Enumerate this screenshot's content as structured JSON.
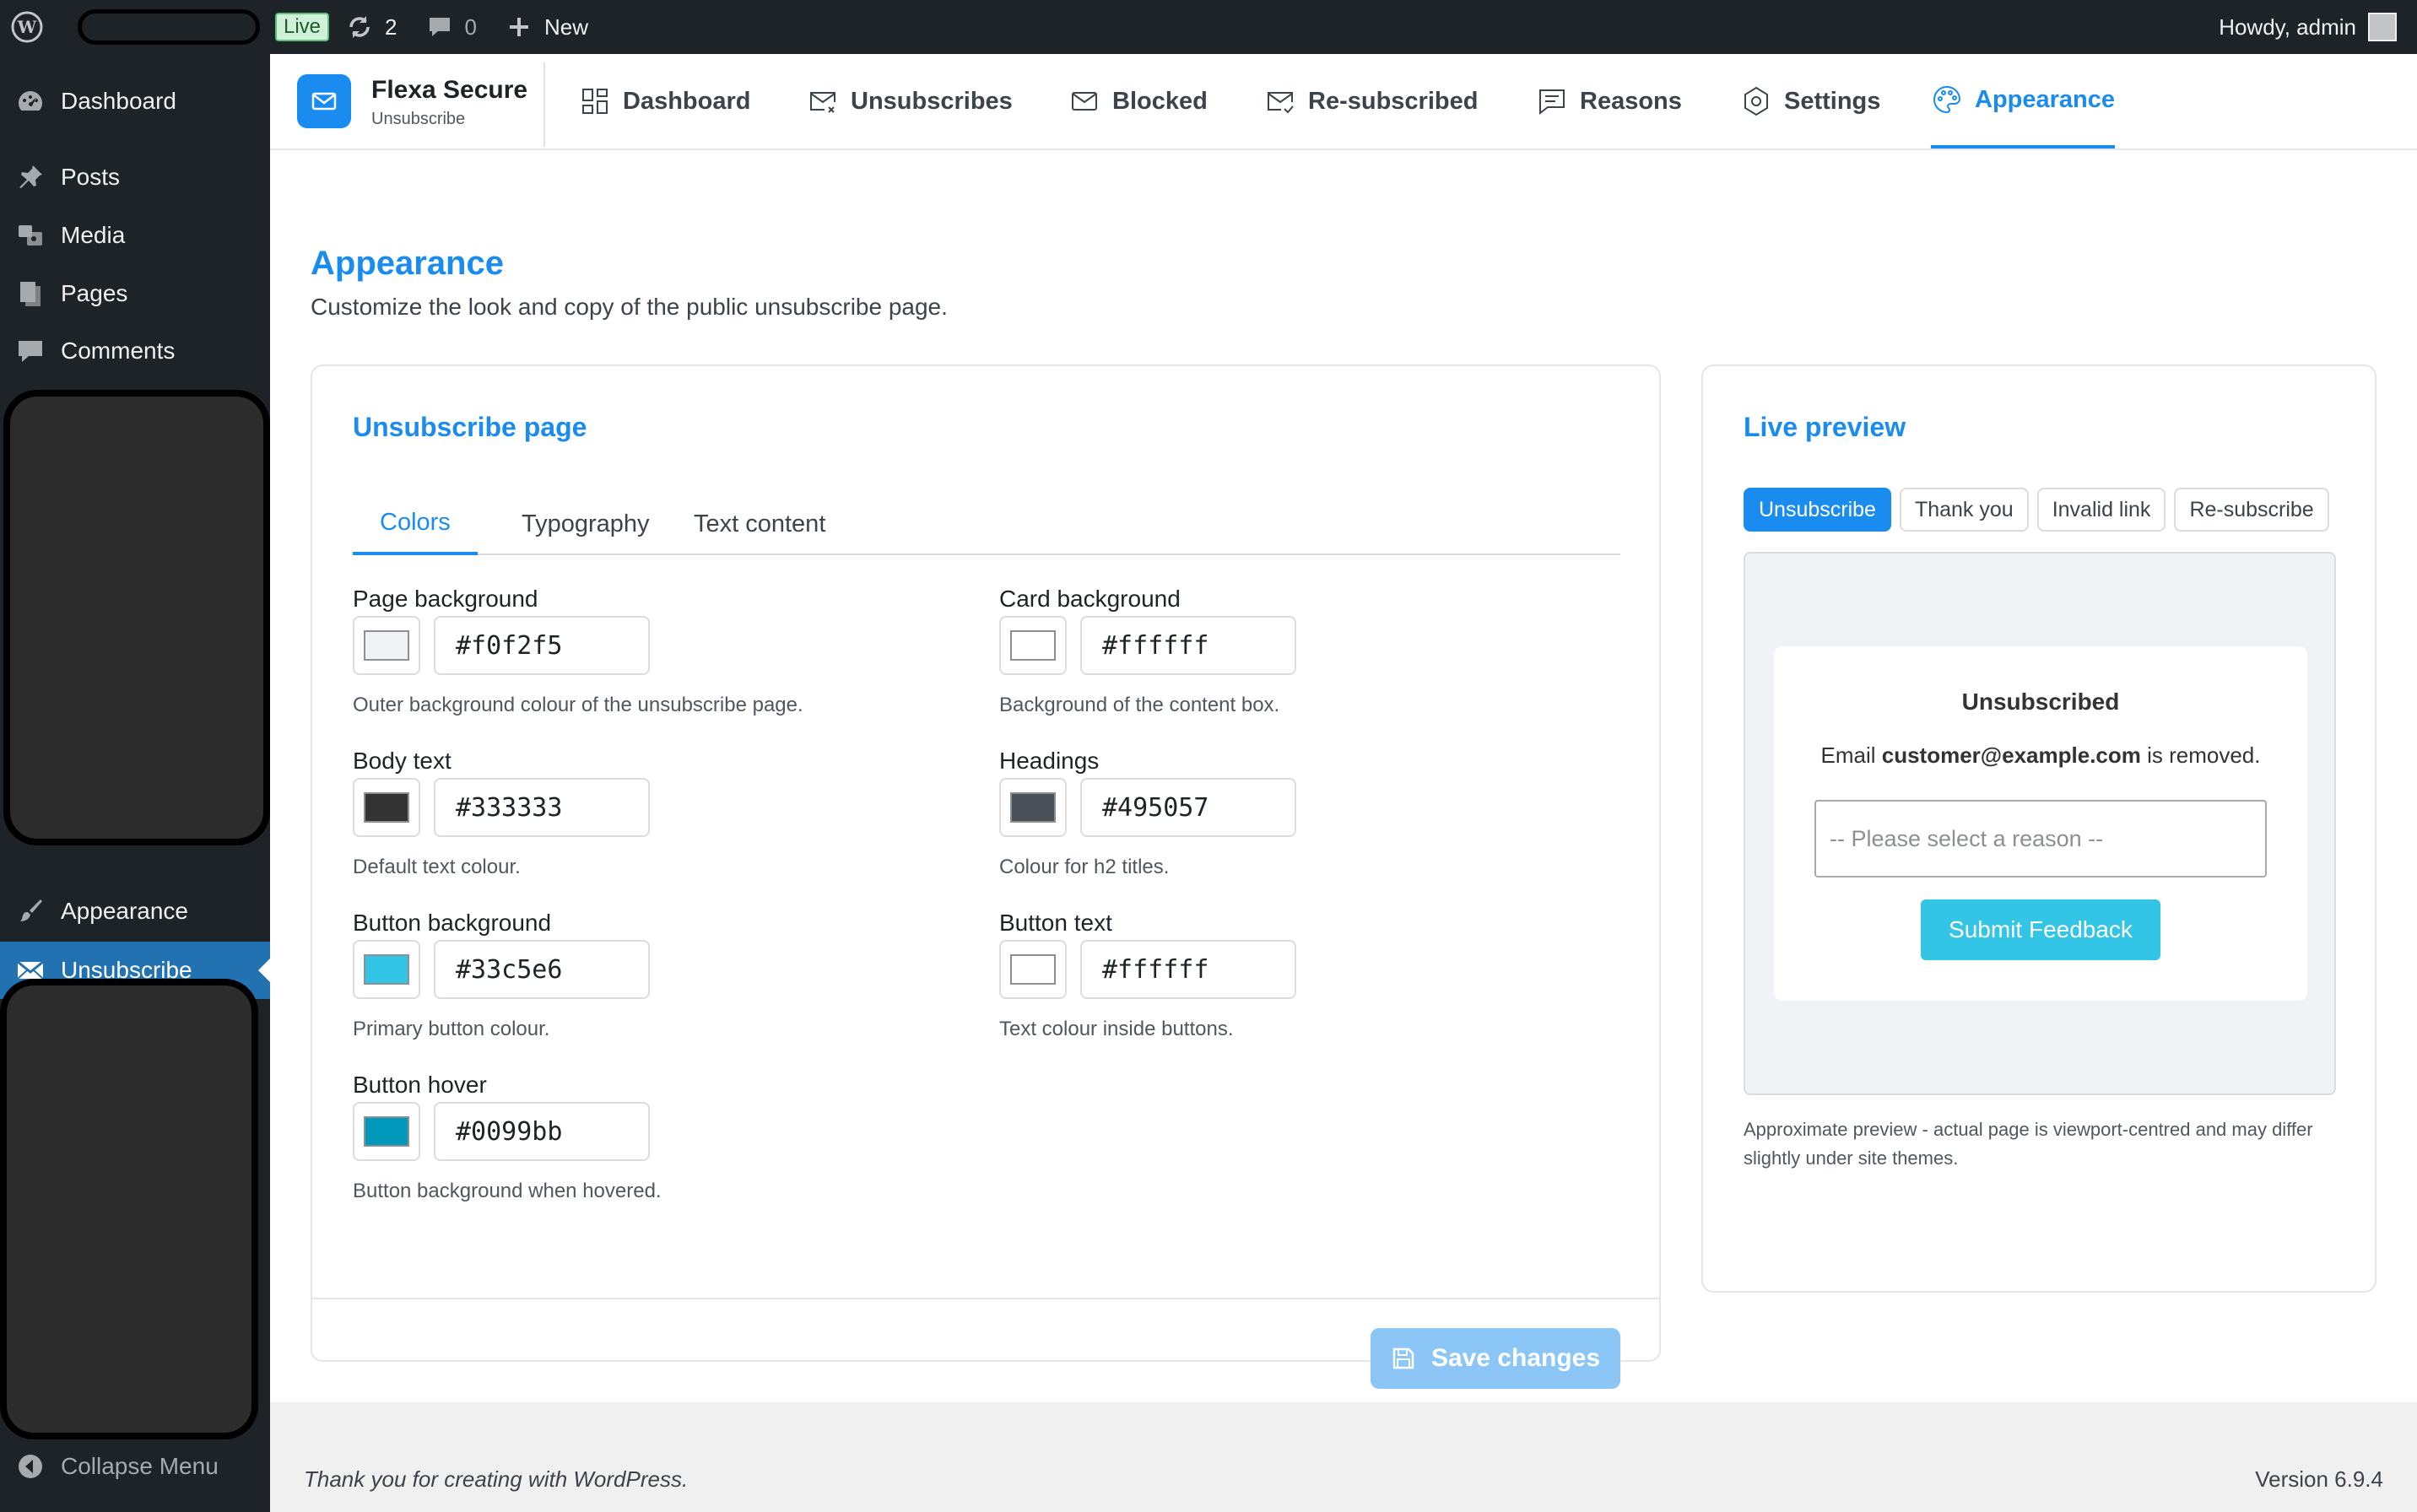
{
  "adminbar": {
    "live_label": "Live",
    "updates_count": "2",
    "comments_count": "0",
    "new_label": "New",
    "howdy": "Howdy, admin"
  },
  "sidebar": {
    "items": [
      {
        "label": "Dashboard",
        "icon": "dashboard-icon"
      },
      {
        "label": "Posts",
        "icon": "pin-icon"
      },
      {
        "label": "Media",
        "icon": "media-icon"
      },
      {
        "label": "Pages",
        "icon": "pages-icon"
      },
      {
        "label": "Comments",
        "icon": "comment-icon"
      },
      {
        "label": "Appearance",
        "icon": "brush-icon"
      },
      {
        "label": "Unsubscribe",
        "icon": "envelope-icon"
      }
    ],
    "collapse_label": "Collapse Menu"
  },
  "plugin": {
    "name": "Flexa Secure",
    "subtitle": "Unsubscribe",
    "tabs": [
      {
        "label": "Dashboard",
        "icon": "grid-icon"
      },
      {
        "label": "Unsubscribes",
        "icon": "mail-x-icon"
      },
      {
        "label": "Blocked",
        "icon": "mail-icon"
      },
      {
        "label": "Re-subscribed",
        "icon": "mail-check-icon"
      },
      {
        "label": "Reasons",
        "icon": "message-icon"
      },
      {
        "label": "Settings",
        "icon": "settings-icon"
      },
      {
        "label": "Appearance",
        "icon": "palette-icon"
      }
    ],
    "active_tab": "Appearance"
  },
  "page": {
    "title": "Appearance",
    "description": "Customize the look and copy of the public unsubscribe page."
  },
  "settings_card": {
    "title": "Unsubscribe page",
    "tabs": [
      "Colors",
      "Typography",
      "Text content"
    ],
    "active_tab": "Colors",
    "fields": [
      {
        "label": "Page background",
        "value": "#f0f2f5",
        "help": "Outer background colour of the unsubscribe page."
      },
      {
        "label": "Card background",
        "value": "#ffffff",
        "help": "Background of the content box."
      },
      {
        "label": "Body text",
        "value": "#333333",
        "help": "Default text colour."
      },
      {
        "label": "Headings",
        "value": "#495057",
        "help": "Colour for h2 titles."
      },
      {
        "label": "Button background",
        "value": "#33c5e6",
        "help": "Primary button colour."
      },
      {
        "label": "Button text",
        "value": "#ffffff",
        "help": "Text colour inside buttons."
      },
      {
        "label": "Button hover",
        "value": "#0099bb",
        "help": "Button background when hovered."
      }
    ],
    "save_label": "Save changes"
  },
  "preview_card": {
    "title": "Live preview",
    "tabs": [
      "Unsubscribe",
      "Thank you",
      "Invalid link",
      "Re-subscribe"
    ],
    "active_tab": "Unsubscribe",
    "heading": "Unsubscribed",
    "email_prefix": "Email",
    "email": "customer@example.com",
    "email_suffix": "is removed.",
    "select_placeholder": "-- Please select a reason --",
    "submit_label": "Submit Feedback",
    "note": "Approximate preview - actual page is viewport-centred and may differ slightly under site themes."
  },
  "footer": {
    "thanks": "Thank you for creating with WordPress.",
    "version": "Version 6.9.4"
  },
  "colors": {
    "accent": "#1a8cf0",
    "admin_dark": "#1d2327",
    "current_menu": "#2271b1"
  }
}
